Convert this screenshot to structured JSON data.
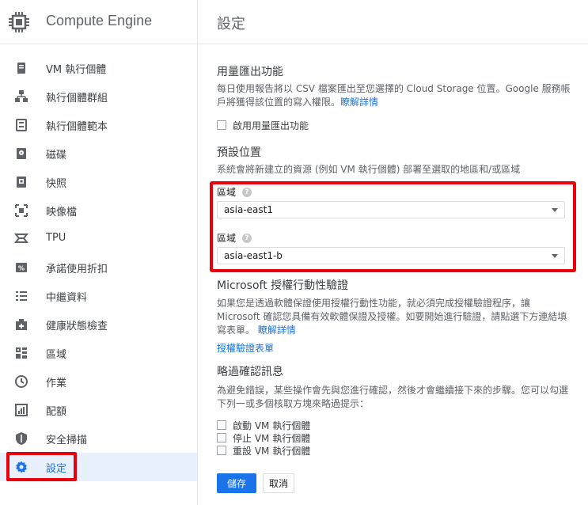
{
  "app": {
    "title": "Compute Engine",
    "logo_icon": "compute-engine-chip-icon"
  },
  "sidebar": {
    "items": [
      {
        "label": "VM 執行個體",
        "icon": "vm-instances-icon"
      },
      {
        "label": "執行個體群組",
        "icon": "instance-groups-icon"
      },
      {
        "label": "執行個體範本",
        "icon": "instance-templates-icon"
      },
      {
        "label": "磁碟",
        "icon": "disks-icon"
      },
      {
        "label": "快照",
        "icon": "snapshots-icon"
      },
      {
        "label": "映像檔",
        "icon": "images-icon"
      },
      {
        "label": "TPU",
        "icon": "tpu-icon"
      },
      {
        "label": "承諾使用折扣",
        "icon": "committed-use-discounts-icon"
      },
      {
        "label": "中繼資料",
        "icon": "metadata-icon"
      },
      {
        "label": "健康狀態檢查",
        "icon": "health-checks-icon"
      },
      {
        "label": "區域",
        "icon": "zones-icon"
      },
      {
        "label": "作業",
        "icon": "operations-icon"
      },
      {
        "label": "配額",
        "icon": "quotas-icon"
      },
      {
        "label": "安全掃描",
        "icon": "security-scan-icon"
      },
      {
        "label": "設定",
        "icon": "gear-icon",
        "active": true
      }
    ]
  },
  "page": {
    "title": "設定"
  },
  "usage_export": {
    "title": "用量匯出功能",
    "description": "每日使用報告將以 CSV 檔案匯出至您選擇的 Cloud Storage 位置。Google 服務帳戶將獲得該位置的寫入權限。",
    "learn_more": "瞭解詳情",
    "checkbox_label": "啟用用量匯出功能"
  },
  "default_location": {
    "title": "預設位置",
    "description": "系統會將新建立的資源 (例如 VM 執行個體) 部署至選取的地區和/或區域",
    "region_label": "區域",
    "region_value": "asia-east1",
    "zone_label": "區域",
    "zone_value": "asia-east1-b"
  },
  "shielded_vm": {
    "title": "Microsoft 授權行動性驗證",
    "description": "如果您是透過軟體保證使用授權行動性功能，就必須完成授權驗證程序，讓 Microsoft 確認您具備有效軟體保證及授權。如要開始進行驗證，請點選下方連結填寫表單。",
    "learn_more": "瞭解詳情",
    "form_link": "授權驗證表單"
  },
  "skip_confirm": {
    "title": "略過確認訊息",
    "description": "為避免錯誤，某些操作會先與您進行確認，然後才會繼續接下來的步驟。您可以勾選下列一或多個核取方塊來略過提示：",
    "options": [
      "啟動 VM 執行個體",
      "停止 VM 執行個體",
      "重設 VM 執行個體"
    ]
  },
  "actions": {
    "save": "儲存",
    "cancel": "取消"
  },
  "colors": {
    "accent": "#1a73e8",
    "highlight": "#e8000b"
  }
}
